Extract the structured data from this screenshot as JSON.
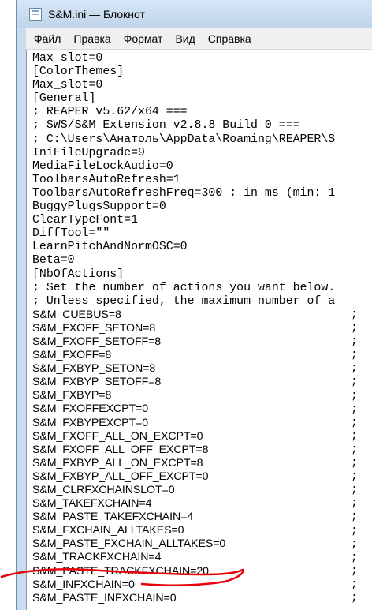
{
  "window": {
    "title": "S&M.ini — Блокнот"
  },
  "menu": [
    "Файл",
    "Правка",
    "Формат",
    "Вид",
    "Справка"
  ],
  "lines": [
    {
      "text": "Max_slot=0",
      "small": false,
      "semicolon": false
    },
    {
      "text": "[ColorThemes]",
      "small": false,
      "semicolon": false
    },
    {
      "text": "Max_slot=0",
      "small": false,
      "semicolon": false
    },
    {
      "text": "[General]",
      "small": false,
      "semicolon": false
    },
    {
      "text": "; REAPER v5.62/x64 ===",
      "small": false,
      "semicolon": false
    },
    {
      "text": "; SWS/S&M Extension v2.8.8 Build 0 ===",
      "small": false,
      "semicolon": false
    },
    {
      "text": "; C:\\Users\\Анатоль\\AppData\\Roaming\\REAPER\\S",
      "small": false,
      "semicolon": false
    },
    {
      "text": "IniFileUpgrade=9",
      "small": false,
      "semicolon": false
    },
    {
      "text": "MediaFileLockAudio=0",
      "small": false,
      "semicolon": false
    },
    {
      "text": "ToolbarsAutoRefresh=1",
      "small": false,
      "semicolon": false
    },
    {
      "text": "ToolbarsAutoRefreshFreq=300 ; in ms (min: 1",
      "small": false,
      "semicolon": false
    },
    {
      "text": "BuggyPlugsSupport=0",
      "small": false,
      "semicolon": false
    },
    {
      "text": "ClearTypeFont=1",
      "small": false,
      "semicolon": false
    },
    {
      "text": "DiffTool=\"\"",
      "small": false,
      "semicolon": false
    },
    {
      "text": "LearnPitchAndNormOSC=0",
      "small": false,
      "semicolon": false
    },
    {
      "text": "Beta=0",
      "small": false,
      "semicolon": false
    },
    {
      "text": "[NbOfActions]",
      "small": false,
      "semicolon": false
    },
    {
      "text": "; Set the number of actions you want below.",
      "small": false,
      "semicolon": false
    },
    {
      "text": "; Unless specified, the maximum number of a",
      "small": false,
      "semicolon": false
    },
    {
      "text": "S&M_CUEBUS=8",
      "small": true,
      "semicolon": true
    },
    {
      "text": "S&M_FXOFF_SETON=8",
      "small": true,
      "semicolon": true
    },
    {
      "text": "S&M_FXOFF_SETOFF=8",
      "small": true,
      "semicolon": true
    },
    {
      "text": "S&M_FXOFF=8",
      "small": true,
      "semicolon": true
    },
    {
      "text": "S&M_FXBYP_SETON=8",
      "small": true,
      "semicolon": true
    },
    {
      "text": "S&M_FXBYP_SETOFF=8",
      "small": true,
      "semicolon": true
    },
    {
      "text": "S&M_FXBYP=8",
      "small": true,
      "semicolon": true
    },
    {
      "text": "S&M_FXOFFEXCPT=0",
      "small": true,
      "semicolon": true
    },
    {
      "text": "S&M_FXBYPEXCPT=0",
      "small": true,
      "semicolon": true
    },
    {
      "text": "S&M_FXOFF_ALL_ON_EXCPT=0",
      "small": true,
      "semicolon": true
    },
    {
      "text": "S&M_FXOFF_ALL_OFF_EXCPT=8",
      "small": true,
      "semicolon": true
    },
    {
      "text": "S&M_FXBYP_ALL_ON_EXCPT=8",
      "small": true,
      "semicolon": true
    },
    {
      "text": "S&M_FXBYP_ALL_OFF_EXCPT=0",
      "small": true,
      "semicolon": true
    },
    {
      "text": "S&M_CLRFXCHAINSLOT=0",
      "small": true,
      "semicolon": true
    },
    {
      "text": "S&M_TAKEFXCHAIN=4",
      "small": true,
      "semicolon": true
    },
    {
      "text": "S&M_PASTE_TAKEFXCHAIN=4",
      "small": true,
      "semicolon": true
    },
    {
      "text": "S&M_FXCHAIN_ALLTAKES=0",
      "small": true,
      "semicolon": true
    },
    {
      "text": "S&M_PASTE_FXCHAIN_ALLTAKES=0",
      "small": true,
      "semicolon": true
    },
    {
      "text": "S&M_TRACKFXCHAIN=4",
      "small": true,
      "semicolon": true
    },
    {
      "text": "S&M_PASTE_TRACKFXCHAIN=20",
      "small": true,
      "semicolon": true
    },
    {
      "text": "S&M_INFXCHAIN=0",
      "small": true,
      "semicolon": true
    },
    {
      "text": "S&M_PASTE_INFXCHAIN=0",
      "small": true,
      "semicolon": true
    }
  ],
  "annotation_color": "#e8000a"
}
